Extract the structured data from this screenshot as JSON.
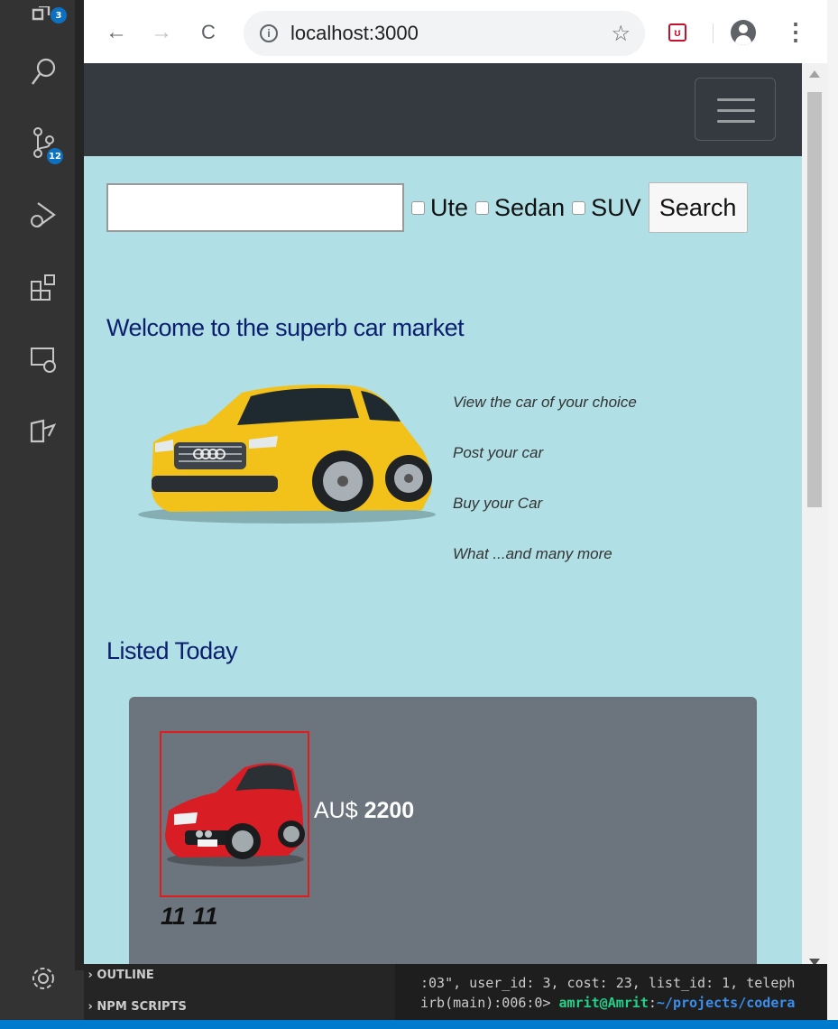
{
  "vscode": {
    "explorer_badge": "3",
    "source_control_badge": "12",
    "panels": [
      "OUTLINE",
      "NPM SCRIPTS"
    ],
    "terminal": {
      "line1": ":03\", user_id: 3, cost: 23, list_id: 1, teleph",
      "line2_prefix": "irb(main):006:0> ",
      "line2_user": "amrit@Amrit",
      "line2_colon": ":",
      "line2_path": "~/projects/codera"
    }
  },
  "browser": {
    "url": "localhost:3000",
    "back_label": "←",
    "forward_label": "→",
    "reload_label": "C",
    "star_label": "☆",
    "ext_label": "ʊ",
    "menu_label": "⋮",
    "info_label": "i"
  },
  "page": {
    "search": {
      "value": "",
      "filters": [
        "Ute",
        "Sedan",
        "SUV"
      ],
      "button_label": "Search"
    },
    "welcome_heading": "Welcome to the superb car market",
    "features": [
      "View the car of your choice",
      "Post your car",
      "Buy your Car",
      "What ...and many more"
    ],
    "listed_heading": "Listed Today",
    "listing": {
      "currency": "AU$",
      "price": "2200",
      "title": "11 11"
    },
    "colors": {
      "page_bg": "#b0dfe5",
      "navbar_bg": "#343a40",
      "heading": "#0b1f6e",
      "card_bg": "#6c757d",
      "card_image_border": "#e21b1b"
    }
  }
}
